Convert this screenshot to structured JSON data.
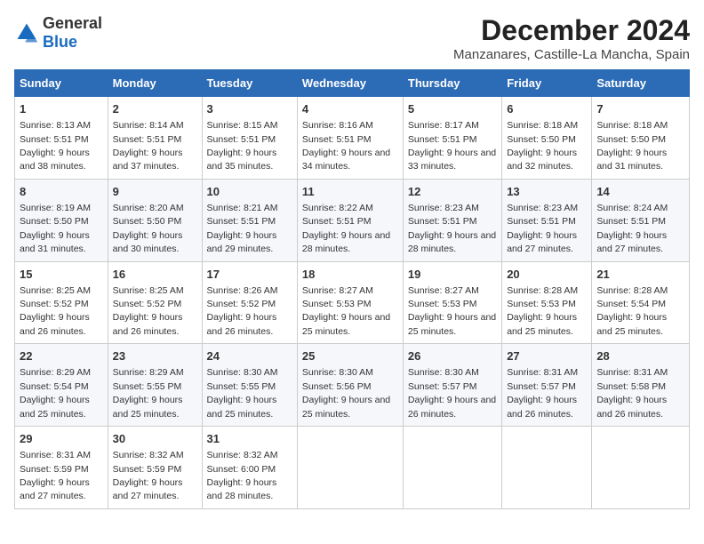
{
  "logo": {
    "general": "General",
    "blue": "Blue"
  },
  "title": "December 2024",
  "subtitle": "Manzanares, Castille-La Mancha, Spain",
  "days_header": [
    "Sunday",
    "Monday",
    "Tuesday",
    "Wednesday",
    "Thursday",
    "Friday",
    "Saturday"
  ],
  "weeks": [
    [
      {
        "day": "1",
        "sunrise": "8:13 AM",
        "sunset": "5:51 PM",
        "daylight": "9 hours and 38 minutes."
      },
      {
        "day": "2",
        "sunrise": "8:14 AM",
        "sunset": "5:51 PM",
        "daylight": "9 hours and 37 minutes."
      },
      {
        "day": "3",
        "sunrise": "8:15 AM",
        "sunset": "5:51 PM",
        "daylight": "9 hours and 35 minutes."
      },
      {
        "day": "4",
        "sunrise": "8:16 AM",
        "sunset": "5:51 PM",
        "daylight": "9 hours and 34 minutes."
      },
      {
        "day": "5",
        "sunrise": "8:17 AM",
        "sunset": "5:51 PM",
        "daylight": "9 hours and 33 minutes."
      },
      {
        "day": "6",
        "sunrise": "8:18 AM",
        "sunset": "5:50 PM",
        "daylight": "9 hours and 32 minutes."
      },
      {
        "day": "7",
        "sunrise": "8:18 AM",
        "sunset": "5:50 PM",
        "daylight": "9 hours and 31 minutes."
      }
    ],
    [
      {
        "day": "8",
        "sunrise": "8:19 AM",
        "sunset": "5:50 PM",
        "daylight": "9 hours and 31 minutes."
      },
      {
        "day": "9",
        "sunrise": "8:20 AM",
        "sunset": "5:50 PM",
        "daylight": "9 hours and 30 minutes."
      },
      {
        "day": "10",
        "sunrise": "8:21 AM",
        "sunset": "5:51 PM",
        "daylight": "9 hours and 29 minutes."
      },
      {
        "day": "11",
        "sunrise": "8:22 AM",
        "sunset": "5:51 PM",
        "daylight": "9 hours and 28 minutes."
      },
      {
        "day": "12",
        "sunrise": "8:23 AM",
        "sunset": "5:51 PM",
        "daylight": "9 hours and 28 minutes."
      },
      {
        "day": "13",
        "sunrise": "8:23 AM",
        "sunset": "5:51 PM",
        "daylight": "9 hours and 27 minutes."
      },
      {
        "day": "14",
        "sunrise": "8:24 AM",
        "sunset": "5:51 PM",
        "daylight": "9 hours and 27 minutes."
      }
    ],
    [
      {
        "day": "15",
        "sunrise": "8:25 AM",
        "sunset": "5:52 PM",
        "daylight": "9 hours and 26 minutes."
      },
      {
        "day": "16",
        "sunrise": "8:25 AM",
        "sunset": "5:52 PM",
        "daylight": "9 hours and 26 minutes."
      },
      {
        "day": "17",
        "sunrise": "8:26 AM",
        "sunset": "5:52 PM",
        "daylight": "9 hours and 26 minutes."
      },
      {
        "day": "18",
        "sunrise": "8:27 AM",
        "sunset": "5:53 PM",
        "daylight": "9 hours and 25 minutes."
      },
      {
        "day": "19",
        "sunrise": "8:27 AM",
        "sunset": "5:53 PM",
        "daylight": "9 hours and 25 minutes."
      },
      {
        "day": "20",
        "sunrise": "8:28 AM",
        "sunset": "5:53 PM",
        "daylight": "9 hours and 25 minutes."
      },
      {
        "day": "21",
        "sunrise": "8:28 AM",
        "sunset": "5:54 PM",
        "daylight": "9 hours and 25 minutes."
      }
    ],
    [
      {
        "day": "22",
        "sunrise": "8:29 AM",
        "sunset": "5:54 PM",
        "daylight": "9 hours and 25 minutes."
      },
      {
        "day": "23",
        "sunrise": "8:29 AM",
        "sunset": "5:55 PM",
        "daylight": "9 hours and 25 minutes."
      },
      {
        "day": "24",
        "sunrise": "8:30 AM",
        "sunset": "5:55 PM",
        "daylight": "9 hours and 25 minutes."
      },
      {
        "day": "25",
        "sunrise": "8:30 AM",
        "sunset": "5:56 PM",
        "daylight": "9 hours and 25 minutes."
      },
      {
        "day": "26",
        "sunrise": "8:30 AM",
        "sunset": "5:57 PM",
        "daylight": "9 hours and 26 minutes."
      },
      {
        "day": "27",
        "sunrise": "8:31 AM",
        "sunset": "5:57 PM",
        "daylight": "9 hours and 26 minutes."
      },
      {
        "day": "28",
        "sunrise": "8:31 AM",
        "sunset": "5:58 PM",
        "daylight": "9 hours and 26 minutes."
      }
    ],
    [
      {
        "day": "29",
        "sunrise": "8:31 AM",
        "sunset": "5:59 PM",
        "daylight": "9 hours and 27 minutes."
      },
      {
        "day": "30",
        "sunrise": "8:32 AM",
        "sunset": "5:59 PM",
        "daylight": "9 hours and 27 minutes."
      },
      {
        "day": "31",
        "sunrise": "8:32 AM",
        "sunset": "6:00 PM",
        "daylight": "9 hours and 28 minutes."
      },
      null,
      null,
      null,
      null
    ]
  ],
  "labels": {
    "sunrise": "Sunrise:",
    "sunset": "Sunset:",
    "daylight": "Daylight:"
  }
}
